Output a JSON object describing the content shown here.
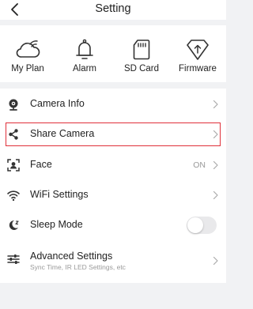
{
  "header": {
    "title": "Setting",
    "back_icon": "chevron-left-icon"
  },
  "quick_actions": [
    {
      "label": "My Plan",
      "icon": "cloud-wifi-icon"
    },
    {
      "label": "Alarm",
      "icon": "bell-icon"
    },
    {
      "label": "SD Card",
      "icon": "sd-card-icon"
    },
    {
      "label": "Firmware",
      "icon": "firmware-upgrade-icon"
    }
  ],
  "settings": {
    "camera_info": {
      "label": "Camera Info",
      "icon": "webcam-icon"
    },
    "share_camera": {
      "label": "Share Camera",
      "icon": "share-icon"
    },
    "face": {
      "label": "Face",
      "value": "ON",
      "icon": "face-scan-icon"
    },
    "wifi": {
      "label": "WiFi Settings",
      "icon": "wifi-icon"
    },
    "sleep": {
      "label": "Sleep Mode",
      "icon": "moon-icon",
      "enabled": false
    },
    "advanced": {
      "label": "Advanced  Settings",
      "sublabel": "Sync Time, IR LED Settings, etc",
      "icon": "sliders-icon"
    }
  },
  "colors": {
    "highlight_border": "#e0303a",
    "page_background": "#f1f2f4",
    "card_background": "#ffffff"
  }
}
